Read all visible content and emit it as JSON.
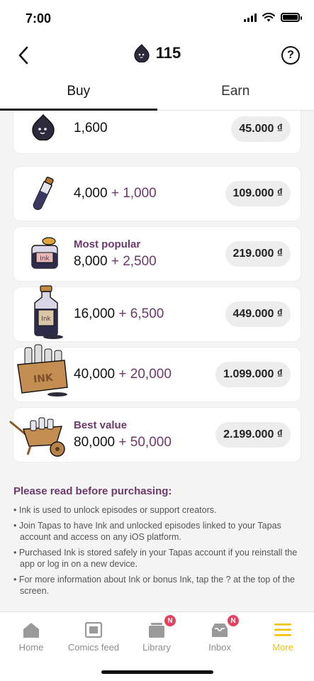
{
  "status_bar": {
    "time": "7:00"
  },
  "header": {
    "balance": "115",
    "help": "?"
  },
  "tabs": [
    {
      "label": "Buy",
      "active": true
    },
    {
      "label": "Earn",
      "active": false
    }
  ],
  "packages": [
    {
      "amount": "1,600",
      "bonus": "",
      "tag": "",
      "price": "45.000 ₫",
      "icon": "ink-drop-icon"
    },
    {
      "amount": "4,000",
      "bonus": "+ 1,000",
      "tag": "",
      "price": "109.000 ₫",
      "icon": "ink-vial-icon"
    },
    {
      "amount": "8,000",
      "bonus": "+ 2,500",
      "tag": "Most popular",
      "price": "219.000 ₫",
      "icon": "ink-jar-icon"
    },
    {
      "amount": "16,000",
      "bonus": "+ 6,500",
      "tag": "",
      "price": "449.000 ₫",
      "icon": "ink-bottle-icon"
    },
    {
      "amount": "40,000",
      "bonus": "+ 20,000",
      "tag": "",
      "price": "1.099.000 ₫",
      "icon": "ink-crate-icon"
    },
    {
      "amount": "80,000",
      "bonus": "+ 50,000",
      "tag": "Best value",
      "price": "2.199.000 ₫",
      "icon": "ink-wheelbarrow-icon"
    }
  ],
  "info": {
    "title": "Please read before purchasing:",
    "items": [
      "• Ink is used to unlock episodes or support creators.",
      "• Join Tapas to have Ink and unlocked episodes linked to your Tapas account and access on any iOS platform.",
      "• Purchased Ink is stored safely in your Tapas account if you reinstall the app or log in on a new device.",
      "• For more information about Ink or bonus Ink, tap the ? at the top of the screen."
    ]
  },
  "nav": [
    {
      "label": "Home",
      "icon": "home-icon",
      "badge": ""
    },
    {
      "label": "Comics feed",
      "icon": "comics-feed-icon",
      "badge": ""
    },
    {
      "label": "Library",
      "icon": "library-icon",
      "badge": "N"
    },
    {
      "label": "Inbox",
      "icon": "inbox-icon",
      "badge": "N"
    },
    {
      "label": "More",
      "icon": "menu-icon",
      "badge": ""
    }
  ],
  "colors": {
    "accent_purple": "#6b3a6b",
    "active_nav": "#f2c200",
    "badge": "#e4425e"
  }
}
